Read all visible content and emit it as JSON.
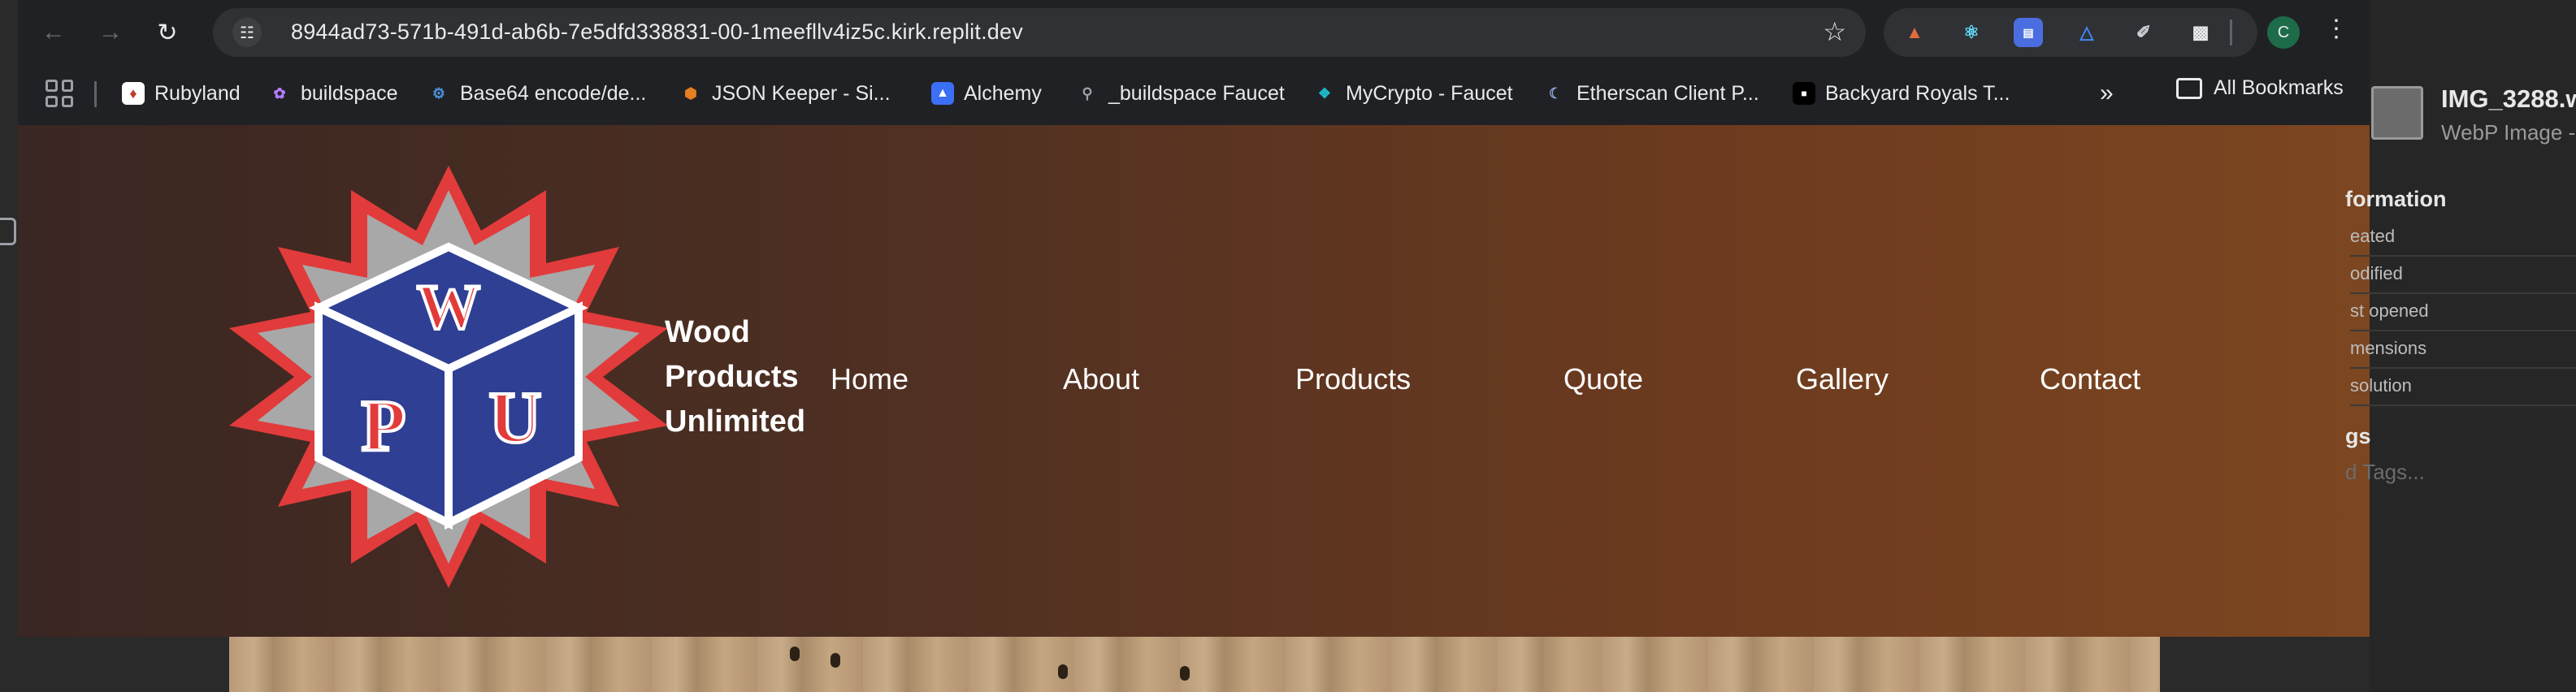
{
  "browser": {
    "url": "8944ad73-571b-491d-ab6b-7e5dfd338831-00-1meefllv4iz5c.kirk.replit.dev",
    "avatar_initial": "C",
    "bookmarks": [
      {
        "label": "Rubyland",
        "icon": "rubyland-icon",
        "color": "#c0392b"
      },
      {
        "label": "buildspace",
        "icon": "buildspace-icon",
        "color": "#b47cff"
      },
      {
        "label": "Base64 encode/de...",
        "icon": "base64-icon",
        "color": "#4a90d9"
      },
      {
        "label": "JSON Keeper - Si...",
        "icon": "json-keeper-icon",
        "color": "#e67e22"
      },
      {
        "label": "Alchemy",
        "icon": "alchemy-icon",
        "color": "#3b6ff5"
      },
      {
        "label": "_buildspace Faucet",
        "icon": "faucet-icon",
        "color": "#9aa0a6"
      },
      {
        "label": "MyCrypto - Faucet",
        "icon": "mycrypto-icon",
        "color": "#1eb8c9"
      },
      {
        "label": "Etherscan Client P...",
        "icon": "etherscan-icon",
        "color": "#21325b"
      },
      {
        "label": "Backyard Royals T...",
        "icon": "backyard-royals-icon",
        "color": "#000000"
      }
    ],
    "all_bookmarks_label": "All Bookmarks"
  },
  "site": {
    "brand_lines": [
      "Wood",
      "Products",
      "Unlimited"
    ],
    "logo_letters": [
      "W",
      "P",
      "U"
    ],
    "nav": [
      "Home",
      "About",
      "Products",
      "Quote",
      "Gallery",
      "Contact"
    ],
    "colors": {
      "logo_red": "#e23b3b",
      "logo_blue": "#2f3f94",
      "logo_gray": "#a8a8a8"
    }
  },
  "finder": {
    "file_name": "IMG_3288.w",
    "file_kind": "WebP Image -",
    "section_information": "formation",
    "rows": [
      "eated",
      "odified",
      "st opened",
      "mensions",
      "solution"
    ],
    "section_tags": "gs",
    "add_tags": "d Tags..."
  }
}
